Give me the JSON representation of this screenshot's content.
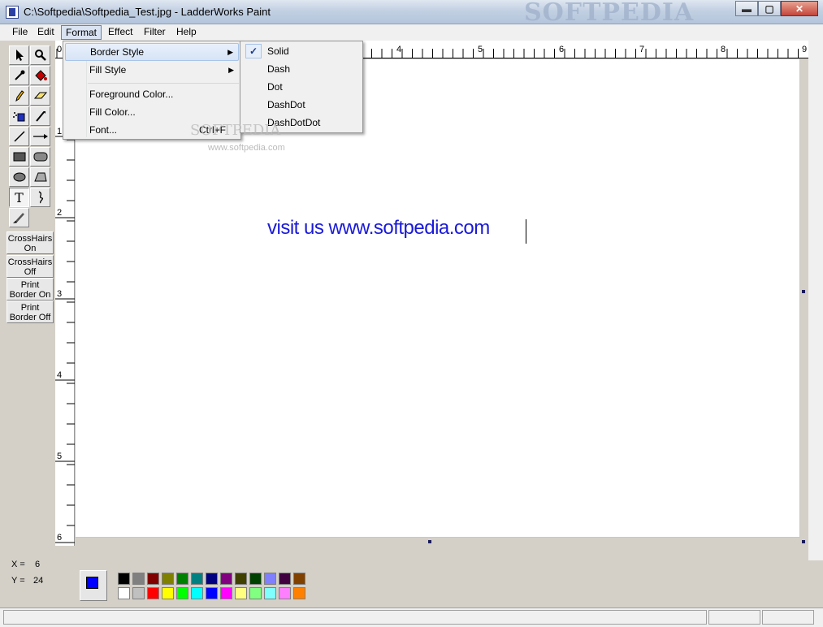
{
  "window": {
    "title": "C:\\Softpedia\\Softpedia_Test.jpg - LadderWorks Paint",
    "watermark": "SOFTPEDIA",
    "buttons": {
      "minimize": "▬",
      "maximize": "▢",
      "close": "✕"
    }
  },
  "menubar": {
    "file": "File",
    "edit": "Edit",
    "format": "Format",
    "effect": "Effect",
    "filter": "Filter",
    "help": "Help"
  },
  "format_menu": {
    "border_style": "Border Style",
    "fill_style": "Fill Style",
    "foreground_color": "Foreground Color...",
    "fill_color": "Fill Color...",
    "font": "Font...",
    "font_shortcut": "Ctrl+F"
  },
  "border_style_menu": {
    "checked": "Solid",
    "items": [
      "Solid",
      "Dash",
      "Dot",
      "DashDot",
      "DashDotDot"
    ],
    "check_mark": "✓"
  },
  "side_buttons": {
    "crosshairs_on": "CrossHairs On",
    "crosshairs_off": "CrossHairs Off",
    "print_border_on": "Print Border On",
    "print_border_off": "Print Border Off"
  },
  "coords": {
    "x_label": "X =",
    "x_value": "6",
    "y_label": "Y =",
    "y_value": "24"
  },
  "canvas": {
    "text": "visit us www.softpedia.com",
    "text_color": "#1a1ad8",
    "watermark": "SOFTPEDIA",
    "watermark_url": "www.softpedia.com"
  },
  "ruler_top": [
    "0",
    "4",
    "5",
    "6",
    "7",
    "8",
    "9"
  ],
  "ruler_left": [
    "1",
    "2",
    "3",
    "4",
    "5",
    "6"
  ],
  "colors": {
    "foreground": "#0000ff",
    "background": "#ffffff",
    "palette": [
      "#000000",
      "#808080",
      "#800000",
      "#808000",
      "#008000",
      "#008080",
      "#000080",
      "#800080",
      "#404000",
      "#004000",
      "#8080ff",
      "#400040",
      "#804000",
      "#ffffff",
      "#c0c0c0",
      "#ff0000",
      "#ffff00",
      "#00ff00",
      "#00ffff",
      "#0000ff",
      "#ff00ff",
      "#ffff80",
      "#80ff80",
      "#80ffff",
      "#ff80ff",
      "#ff8000"
    ]
  }
}
